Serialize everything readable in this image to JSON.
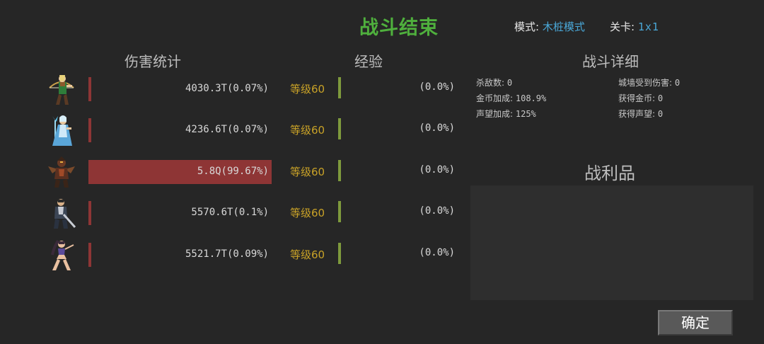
{
  "title": "战斗结束",
  "mode": {
    "label": "模式:",
    "value": "木桩模式"
  },
  "stage": {
    "label": "关卡:",
    "value": "1x1"
  },
  "sections": {
    "damage": "伤害统计",
    "exp": "经验",
    "detail": "战斗详细",
    "loot": "战利品"
  },
  "heroes": [
    {
      "icon": "archer-hero-icon",
      "damage_text": "4030.3T(0.07%)",
      "damage_share": 0.0007,
      "level": "等级60",
      "exp_text": "(0.0%)",
      "exp_progress": 0.0
    },
    {
      "icon": "ice-mage-hero-icon",
      "damage_text": "4236.6T(0.07%)",
      "damage_share": 0.0007,
      "level": "等级60",
      "exp_text": "(0.0%)",
      "exp_progress": 0.0
    },
    {
      "icon": "dark-warrior-hero-icon",
      "damage_text": "5.8Q(99.67%)",
      "damage_share": 0.9967,
      "level": "等级60",
      "exp_text": "(0.0%)",
      "exp_progress": 0.0
    },
    {
      "icon": "swordsman-hero-icon",
      "damage_text": "5570.6T(0.1%)",
      "damage_share": 0.001,
      "level": "等级60",
      "exp_text": "(0.0%)",
      "exp_progress": 0.0
    },
    {
      "icon": "dancer-hero-icon",
      "damage_text": "5521.7T(0.09%)",
      "damage_share": 0.0009,
      "level": "等级60",
      "exp_text": "(0.0%)",
      "exp_progress": 0.0
    }
  ],
  "stats": {
    "kills": {
      "label": "杀敌数:",
      "value": "0"
    },
    "gold_bonus": {
      "label": "金币加成:",
      "value": "108.9%"
    },
    "fame_bonus": {
      "label": "声望加成:",
      "value": "125%"
    },
    "wall_damage": {
      "label": "城墙受到伤害:",
      "value": "0"
    },
    "gold_gained": {
      "label": "获得金币:",
      "value": "0"
    },
    "fame_gained": {
      "label": "获得声望:",
      "value": "0"
    }
  },
  "confirm_label": "确定",
  "colors": {
    "background": "#262626",
    "title": "#4fb03d",
    "mode_value": "#4aa8d8",
    "damage_bar": "#8e3535",
    "level_text": "#c9a227",
    "exp_bar": "#7e9a3c",
    "loot_panel": "#2e2e2e",
    "button": "#595959"
  }
}
